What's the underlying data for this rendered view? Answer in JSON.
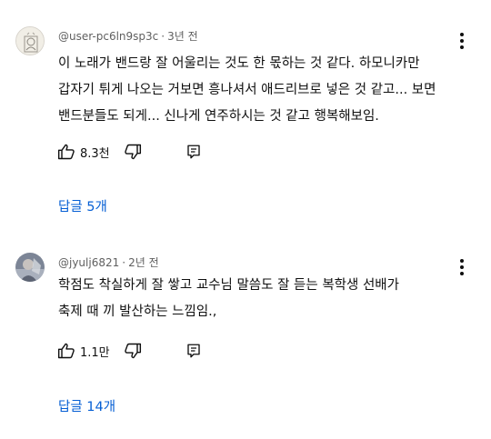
{
  "comments": [
    {
      "handle": "@user-pc6ln9sp3c",
      "separator": "·",
      "time": "3년 전",
      "lines": [
        "이 노래가 밴드랑 잘 어울리는 것도 한 몫하는 것 같다. 하모니카만",
        "갑자기 튀게 나오는 거보면 흥나셔서 애드리브로 넣은 것 같고... 보면",
        "밴드분들도 되게... 신나게 연주하시는 것 같고 행복해보임."
      ],
      "likes": "8.3천",
      "replies_label": "답글 5개",
      "avatar_icon": "profile-sketch-avatar"
    },
    {
      "handle": "@jyulj6821",
      "separator": "·",
      "time": "2년 전",
      "lines": [
        "학점도 착실하게 잘 쌓고 교수님 말씀도 잘 듣는 복학생 선배가",
        "축제 때 끼 발산하는 느낌임.,"
      ],
      "likes": "1.1만",
      "replies_label": "답글 14개",
      "avatar_icon": "profile-photo-avatar"
    }
  ],
  "icons": {
    "like": "thumbs-up-icon",
    "dislike": "thumbs-down-icon",
    "reply": "reply-comment-icon",
    "more": "more-vert-icon"
  },
  "colors": {
    "text": "#0f0f0f",
    "meta": "#606060",
    "link": "#065fd4"
  }
}
